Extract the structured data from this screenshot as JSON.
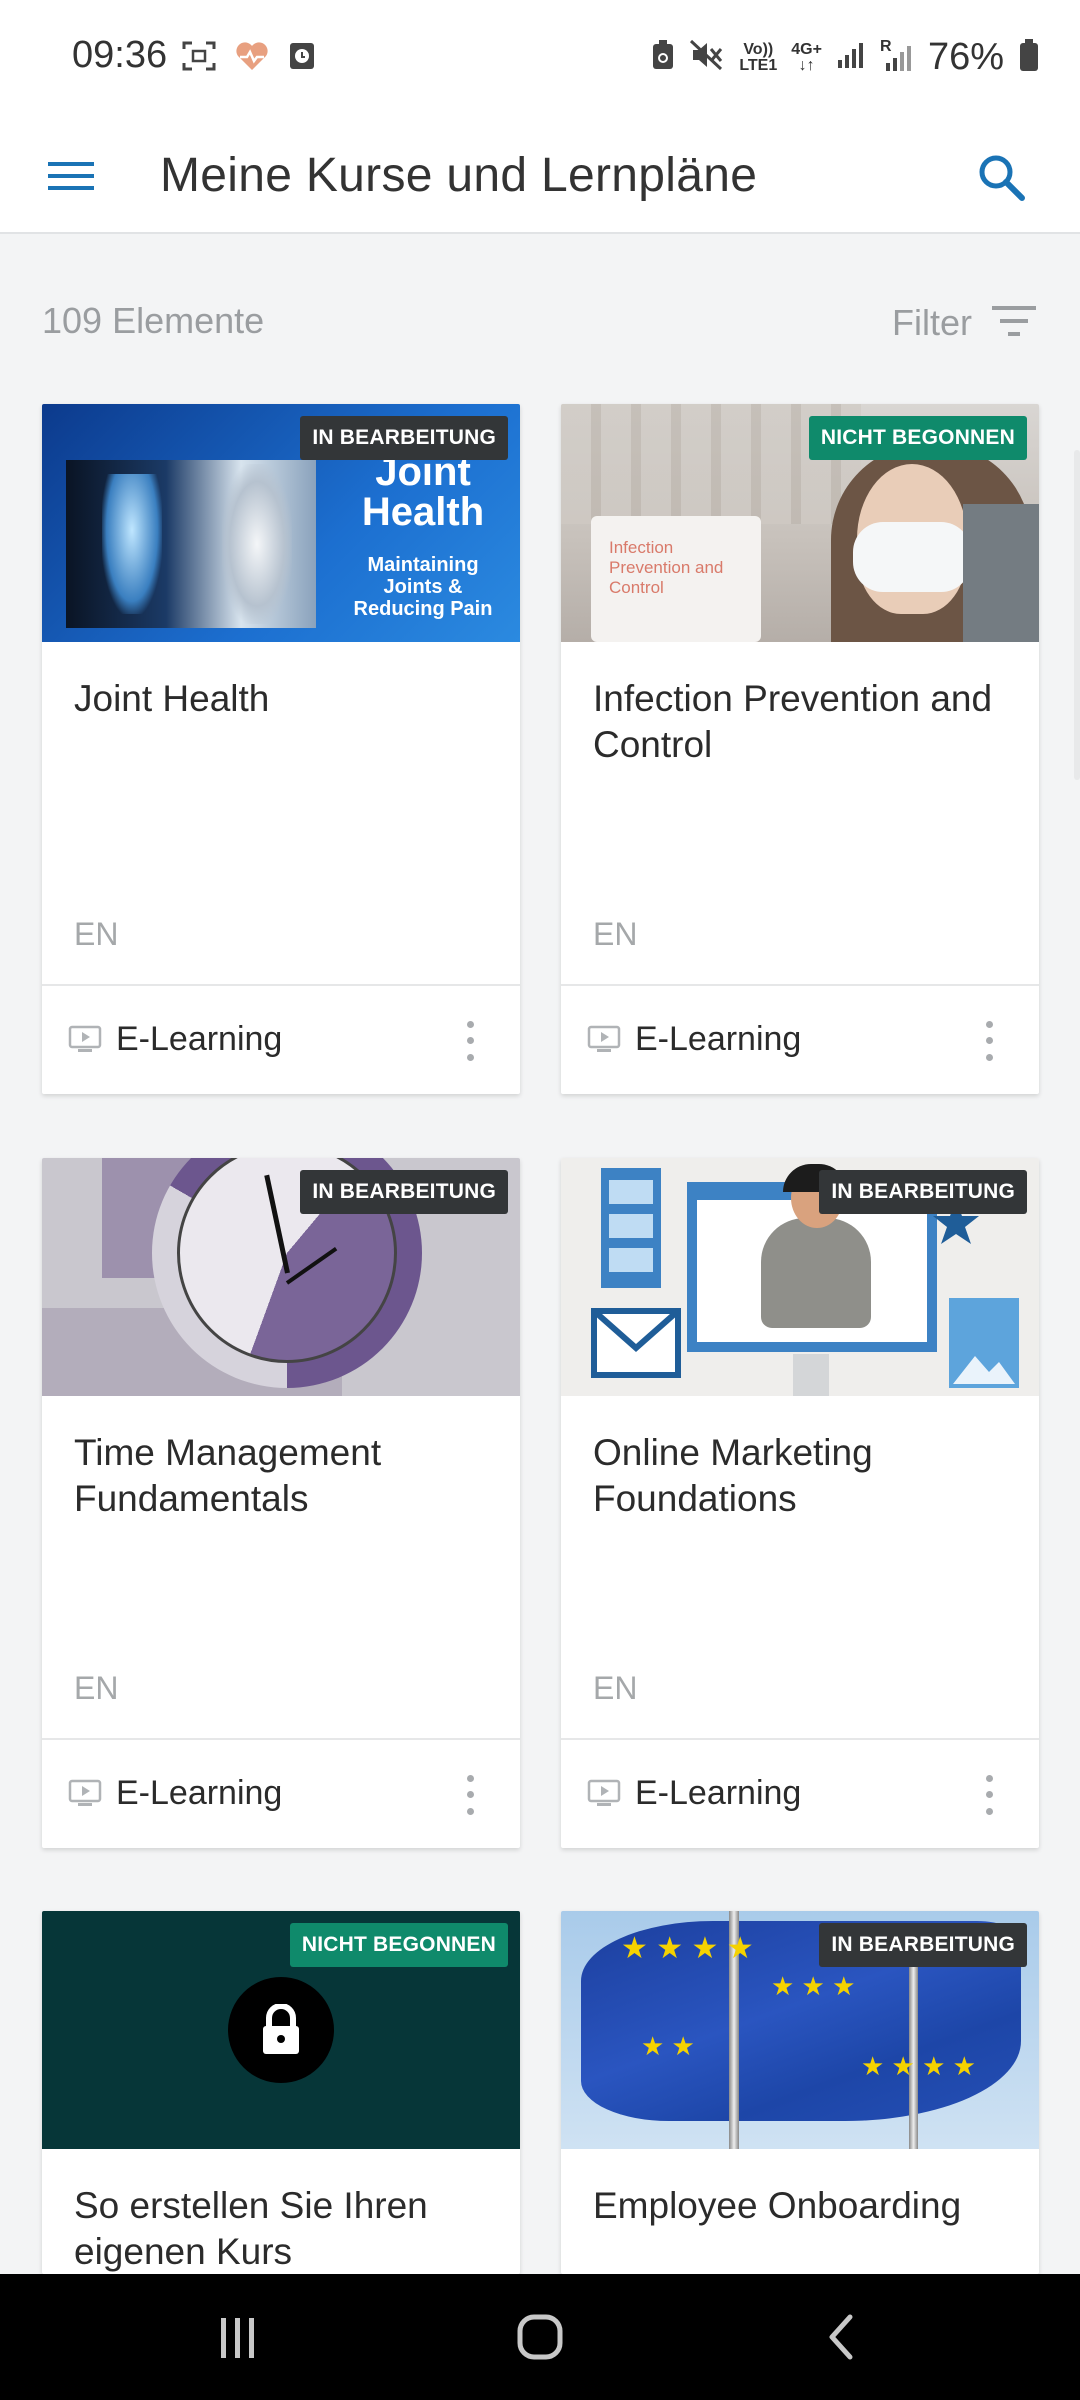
{
  "status_bar": {
    "time": "09:36",
    "battery_text": "76%",
    "net_volte": "Vo))",
    "net_lte": "LTE1",
    "net_4g": "4G+",
    "net_r": "R",
    "icons": [
      "screenshot-icon",
      "health-icon",
      "clock-icon",
      "battery-saver-icon",
      "mute-icon",
      "signal-icon",
      "battery-icon"
    ]
  },
  "header": {
    "title": "Meine Kurse und Lernpläne",
    "menu_icon": "hamburger-icon",
    "search_icon": "search-icon"
  },
  "list_toolbar": {
    "count_label": "109 Elemente",
    "filter_label": "Filter"
  },
  "courses": [
    {
      "status": "IN BEARBEITUNG",
      "title": "Joint Health",
      "language": "EN",
      "type": "E-Learning",
      "thumb": {
        "headline1": "Joint",
        "headline2": "Health",
        "sub1": "Maintaining",
        "sub2": "Joints &",
        "sub3": "Reducing Pain"
      }
    },
    {
      "status": "NICHT BEGONNEN",
      "title": "Infection Prevention and Control",
      "language": "EN",
      "type": "E-Learning",
      "thumb": {
        "sign1": "Infection",
        "sign2": "Prevention and",
        "sign3": "Control"
      }
    },
    {
      "status": "IN BEARBEITUNG",
      "title": "Time Management Fundamentals",
      "language": "EN",
      "type": "E-Learning"
    },
    {
      "status": "IN BEARBEITUNG",
      "title": "Online Marketing Foundations",
      "language": "EN",
      "type": "E-Learning"
    },
    {
      "status": "NICHT BEGONNEN",
      "title": "So erstellen Sie Ihren eigenen Kurs",
      "language": "",
      "type": ""
    },
    {
      "status": "IN BEARBEITUNG",
      "title": "Employee Onboarding",
      "language": "",
      "type": ""
    }
  ],
  "colors": {
    "accent": "#1a73b5",
    "badge_in_progress": "#333638",
    "badge_not_started": "#0f8a6b",
    "background": "#f3f4f5"
  },
  "nav_bar": {
    "buttons": [
      "recents-icon",
      "home-icon",
      "back-icon"
    ]
  }
}
